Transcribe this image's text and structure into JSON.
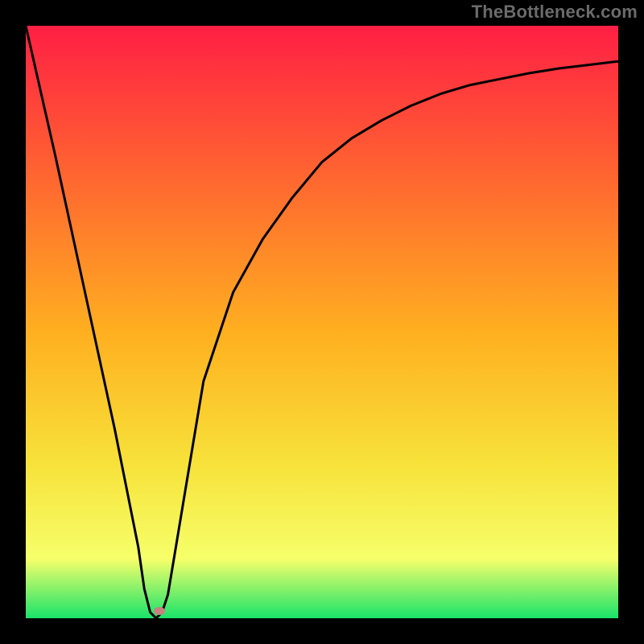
{
  "watermark": "TheBottleneck.com",
  "marker": {
    "x_pct": 22.5,
    "y_pct": 98.8,
    "color": "#c97f7f"
  },
  "gradient": {
    "top": "#ff1f44",
    "q1": "#ff6a2f",
    "mid": "#ffb020",
    "q3": "#f7e23a",
    "low": "#f6ff6a",
    "bottom": "#19e36a"
  },
  "curve_stroke": "#000000",
  "curve_width": 3,
  "chart_data": {
    "type": "line",
    "title": "",
    "xlabel": "",
    "ylabel": "",
    "xlim": [
      0,
      100
    ],
    "ylim": [
      0,
      100
    ],
    "grid": false,
    "legend": false,
    "series": [
      {
        "name": "bottleneck-curve",
        "x": [
          0,
          5,
          10,
          15,
          19,
          20,
          21,
          22,
          23,
          24,
          25,
          27,
          30,
          35,
          40,
          45,
          50,
          55,
          60,
          65,
          70,
          75,
          80,
          85,
          90,
          95,
          100
        ],
        "y": [
          100,
          78,
          55,
          32,
          12,
          5,
          1,
          0,
          1,
          4,
          10,
          22,
          40,
          55,
          64,
          71,
          77,
          81,
          84,
          86.5,
          88.5,
          90,
          91,
          92,
          92.8,
          93.4,
          94
        ]
      }
    ],
    "markers": [
      {
        "name": "target",
        "x": 22.5,
        "y": 1.2
      }
    ],
    "notes": "x/y expressed in percent of the plot area; y=0 is the bottom (green), y=100 is the top (red). Axes are unlabeled in the source image; values are visual estimates."
  }
}
